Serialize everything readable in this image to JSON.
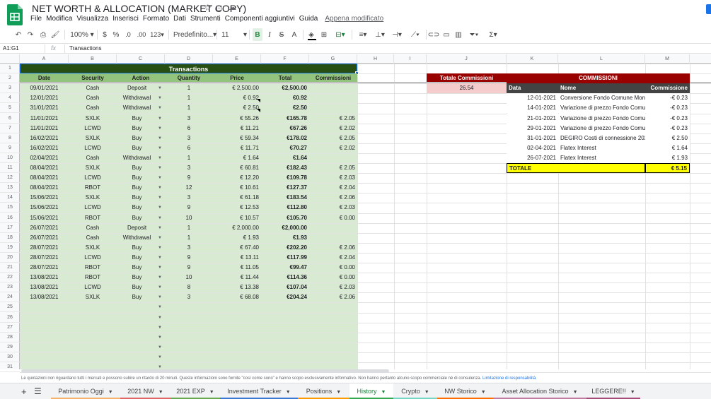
{
  "app": {
    "title": "NET WORTH & ALLOCATION (MARKET COPY)",
    "menu": [
      "File",
      "Modifica",
      "Visualizza",
      "Inserisci",
      "Formato",
      "Dati",
      "Strumenti",
      "Componenti aggiuntivi",
      "Guida"
    ],
    "last_edit": "Appena modificato"
  },
  "toolbar": {
    "zoom": "100%",
    "currency": "$",
    "percent": "%",
    "dec_less": ".0",
    "dec_more": ".00",
    "format_more": "123",
    "font": "Predefinito...",
    "font_size": "11",
    "bold": "B",
    "italic": "I",
    "strike": "S",
    "text_color": "A"
  },
  "formula_bar": {
    "name_box": "A1:G1",
    "fx": "fx",
    "value": "Transactions"
  },
  "columns": [
    "A",
    "B",
    "C",
    "D",
    "E",
    "F",
    "G",
    "H",
    "I",
    "J",
    "K",
    "L",
    "M"
  ],
  "transactions": {
    "title": "Transactions",
    "headers": [
      "Date",
      "Security",
      "Action",
      "Quantity",
      "Price",
      "Total",
      "Commissioni"
    ],
    "rows": [
      [
        "09/01/2021",
        "Cash",
        "Deposit",
        "1",
        "€ 2,500.00",
        "€2,500.00",
        ""
      ],
      [
        "12/01/2021",
        "Cash",
        "Withdrawal",
        "1",
        "€ 0.92",
        "€0.92",
        ""
      ],
      [
        "31/01/2021",
        "Cash",
        "Withdrawal",
        "1",
        "€ 2.50",
        "€2.50",
        ""
      ],
      [
        "11/01/2021",
        "SXLK",
        "Buy",
        "3",
        "€ 55.26",
        "€165.78",
        "€ 2.05"
      ],
      [
        "11/01/2021",
        "LCWD",
        "Buy",
        "6",
        "€ 11.21",
        "€67.26",
        "€ 2.02"
      ],
      [
        "16/02/2021",
        "SXLK",
        "Buy",
        "3",
        "€ 59.34",
        "€178.02",
        "€ 2.05"
      ],
      [
        "16/02/2021",
        "LCWD",
        "Buy",
        "6",
        "€ 11.71",
        "€70.27",
        "€ 2.02"
      ],
      [
        "02/04/2021",
        "Cash",
        "Withdrawal",
        "1",
        "€ 1.64",
        "€1.64",
        ""
      ],
      [
        "08/04/2021",
        "SXLK",
        "Buy",
        "3",
        "€ 60.81",
        "€182.43",
        "€ 2.05"
      ],
      [
        "08/04/2021",
        "LCWD",
        "Buy",
        "9",
        "€ 12.20",
        "€109.78",
        "€ 2.03"
      ],
      [
        "08/04/2021",
        "RBOT",
        "Buy",
        "12",
        "€ 10.61",
        "€127.37",
        "€ 2.04"
      ],
      [
        "15/06/2021",
        "SXLK",
        "Buy",
        "3",
        "€ 61.18",
        "€183.54",
        "€ 2.06"
      ],
      [
        "15/06/2021",
        "LCWD",
        "Buy",
        "9",
        "€ 12.53",
        "€112.80",
        "€ 2.03"
      ],
      [
        "15/06/2021",
        "RBOT",
        "Buy",
        "10",
        "€ 10.57",
        "€105.70",
        "€ 0.00"
      ],
      [
        "26/07/2021",
        "Cash",
        "Deposit",
        "1",
        "€ 2,000.00",
        "€2,000.00",
        ""
      ],
      [
        "26/07/2021",
        "Cash",
        "Withdrawal",
        "1",
        "€ 1.93",
        "€1.93",
        ""
      ],
      [
        "28/07/2021",
        "SXLK",
        "Buy",
        "3",
        "€ 67.40",
        "€202.20",
        "€ 2.06"
      ],
      [
        "28/07/2021",
        "LCWD",
        "Buy",
        "9",
        "€ 13.11",
        "€117.99",
        "€ 2.04"
      ],
      [
        "28/07/2021",
        "RBOT",
        "Buy",
        "9",
        "€ 11.05",
        "€99.47",
        "€ 0.00"
      ],
      [
        "13/08/2021",
        "RBOT",
        "Buy",
        "10",
        "€ 11.44",
        "€114.36",
        "€ 0.00"
      ],
      [
        "13/08/2021",
        "LCWD",
        "Buy",
        "8",
        "€ 13.38",
        "€107.04",
        "€ 2.03"
      ],
      [
        "13/08/2021",
        "SXLK",
        "Buy",
        "3",
        "€ 68.08",
        "€204.24",
        "€ 2.06"
      ]
    ]
  },
  "totale_commissioni": {
    "label": "Totale Commissioni",
    "value": "26.54"
  },
  "commissioni": {
    "title": "COMMISSIONI",
    "headers": [
      "Data",
      "Nome",
      "Commissione"
    ],
    "rows": [
      [
        "12-01-2021",
        "Conversione Fondo Comune Mon",
        "-€ 0.23"
      ],
      [
        "14-01-2021",
        "Variazione di prezzo Fondo Comu",
        "-€ 0.23"
      ],
      [
        "21-01-2021",
        "Variazione di prezzo Fondo Comu",
        "-€ 0.23"
      ],
      [
        "29-01-2021",
        "Variazione di prezzo Fondo Comu",
        "-€ 0.23"
      ],
      [
        "31-01-2021",
        "DEGIRO Costi di connessione 202",
        "€ 2.50"
      ],
      [
        "02-04-2021",
        "Flatex Interest",
        "€ 1.64"
      ],
      [
        "26-07-2021",
        "Flatex Interest",
        "€ 1.93"
      ]
    ],
    "total_label": "TOTALE",
    "total_value": "€ 5.15"
  },
  "disclaimer": "Le quotazioni non riguardano tutti i mercati e possono subire un ritardo di 20 minuti. Queste informazioni sono fornite \"così come sono\" e hanno scopo esclusivamente informativo. Non hanno pertanto alcuno scopo commerciale né di consulenza.",
  "disclaimer_link": "Limitazione di responsabilità",
  "sheet_tabs": [
    {
      "label": "Patrimonio Oggi",
      "color": "#f6b26b"
    },
    {
      "label": "2021 NW",
      "color": "#e06666"
    },
    {
      "label": "2021 EXP",
      "color": "#6aa84f"
    },
    {
      "label": "Investment Tracker",
      "color": "#3c78d8"
    },
    {
      "label": "Positions",
      "color": "#ff9900"
    },
    {
      "label": "History",
      "color": "#34a853",
      "active": true
    },
    {
      "label": "Crypto",
      "color": "#76d7c4"
    },
    {
      "label": "NW Storico",
      "color": "#ff6d01"
    },
    {
      "label": "Asset Allocation Storico",
      "color": "#c27ba0"
    },
    {
      "label": "LEGGERE!!",
      "color": "#a64d79"
    }
  ],
  "colors": {
    "header_dark_green": "#274e13",
    "header_green": "#93c47d",
    "body_green": "#d9ead3",
    "dark_red": "#990000",
    "light_red": "#f4cccc",
    "dark_gray": "#434343",
    "yellow": "#ffff00",
    "sheets_green": "#188038"
  }
}
